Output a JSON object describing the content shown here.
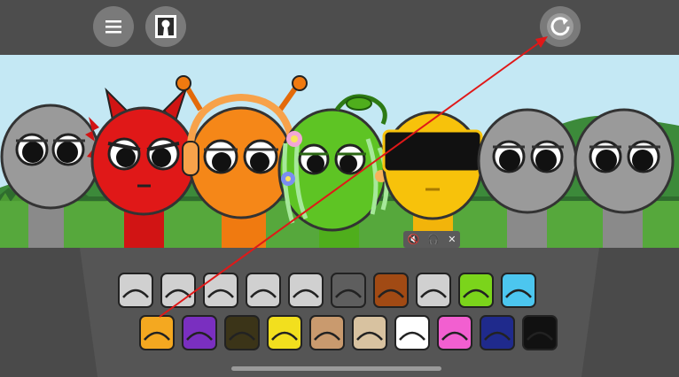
{
  "top_buttons": {
    "menu_icon": "menu-icon",
    "character_icon": "portrait-icon",
    "reset_icon": "reset-icon"
  },
  "stage": {
    "characters": [
      {
        "name": "gray",
        "color": "#9a9a9a"
      },
      {
        "name": "red-devil",
        "color": "#e01818"
      },
      {
        "name": "orange-headphones",
        "color": "#f07a10"
      },
      {
        "name": "green-leaf",
        "color": "#5ec424"
      },
      {
        "name": "yellow-visor",
        "color": "#f7c20b"
      },
      {
        "name": "gray",
        "color": "#9a9a9a"
      },
      {
        "name": "gray",
        "color": "#9a9a9a"
      }
    ]
  },
  "sound_controls": {
    "mute_icon": "speaker-mute-icon",
    "headphones_icon": "headphones-icon",
    "close_icon": "close-icon"
  },
  "palette": {
    "row1": [
      {
        "name": "tile-gray-headband",
        "bg": "#d0d0d0"
      },
      {
        "name": "tile-gray-spiky",
        "bg": "#d0d0d0"
      },
      {
        "name": "tile-gray-halo",
        "bg": "#d0d0d0"
      },
      {
        "name": "tile-gray-bar",
        "bg": "#d0d0d0"
      },
      {
        "name": "tile-gray-hat",
        "bg": "#d0d0d0"
      },
      {
        "name": "tile-gray-ears",
        "bg": "#5e5e5e"
      },
      {
        "name": "tile-brown-box",
        "bg": "#a14a14"
      },
      {
        "name": "tile-gray-band",
        "bg": "#d0d0d0"
      },
      {
        "name": "tile-green-spikes",
        "bg": "#7bd41b"
      },
      {
        "name": "tile-cyan-ears",
        "bg": "#4cc6ef"
      }
    ],
    "row2": [
      {
        "name": "tile-orange-burst",
        "bg": "#f4a820"
      },
      {
        "name": "tile-purple-horns",
        "bg": "#7a2fc0"
      },
      {
        "name": "tile-olive-leaf",
        "bg": "#3b3418"
      },
      {
        "name": "tile-yellow-hair",
        "bg": "#f2df1e"
      },
      {
        "name": "tile-tan-cap",
        "bg": "#c99a6e"
      },
      {
        "name": "tile-propeller-hat",
        "bg": "#d8c2a0"
      },
      {
        "name": "tile-white-cat",
        "bg": "#ffffff"
      },
      {
        "name": "tile-pink-bunny",
        "bg": "#f25fd0"
      },
      {
        "name": "tile-navy-dome",
        "bg": "#1f2a8c"
      },
      {
        "name": "tile-black-frame",
        "bg": "#111111"
      }
    ]
  },
  "annotation": {
    "color": "#e01818"
  }
}
